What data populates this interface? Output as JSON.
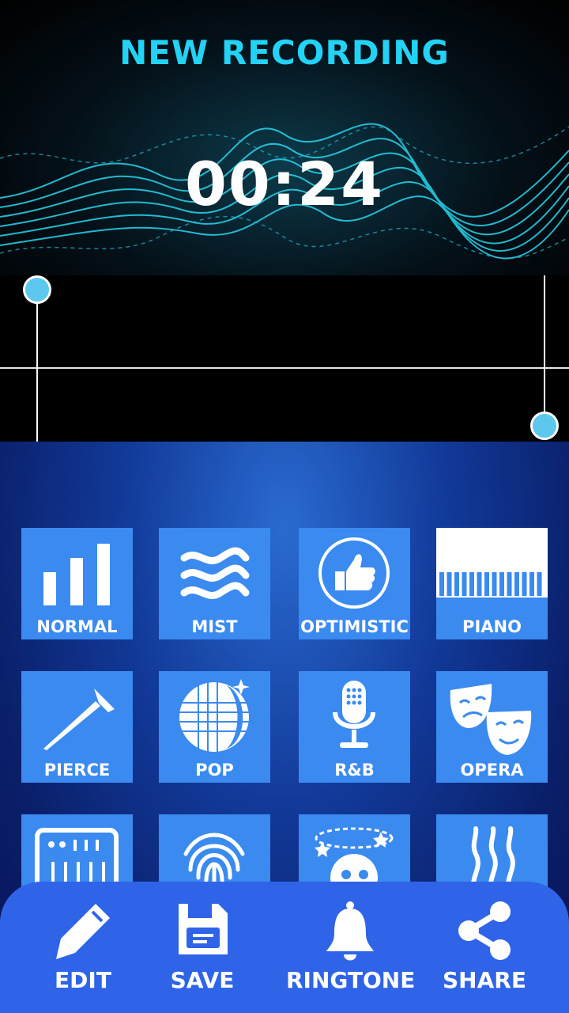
{
  "header": {
    "title": "NEW RECORDING",
    "timer": "00:24"
  },
  "effects": [
    {
      "label": "NORMAL",
      "icon": "bars-icon"
    },
    {
      "label": "MIST",
      "icon": "waves-icon"
    },
    {
      "label": "OPTIMISTIC",
      "icon": "thumbs-up-icon"
    },
    {
      "label": "PIANO",
      "icon": "piano-keys-icon"
    },
    {
      "label": "PIERCE",
      "icon": "nail-icon"
    },
    {
      "label": "POP",
      "icon": "disco-ball-icon"
    },
    {
      "label": "R&B",
      "icon": "microphone-icon"
    },
    {
      "label": "OPERA",
      "icon": "theater-masks-icon"
    },
    {
      "label": "",
      "icon": "synthesizer-icon"
    },
    {
      "label": "",
      "icon": "fingerprint-icon"
    },
    {
      "label": "",
      "icon": "dizzy-face-icon"
    },
    {
      "label": "",
      "icon": "steam-icon"
    }
  ],
  "actions": {
    "edit": "EDIT",
    "save": "SAVE",
    "ringtone": "RINGTONE",
    "share": "SHARE"
  },
  "colors": {
    "title": "#22d3f5",
    "tile": "#3a8af0",
    "bottom_bar": "#2f64e8",
    "handle": "#5cc8ee"
  }
}
